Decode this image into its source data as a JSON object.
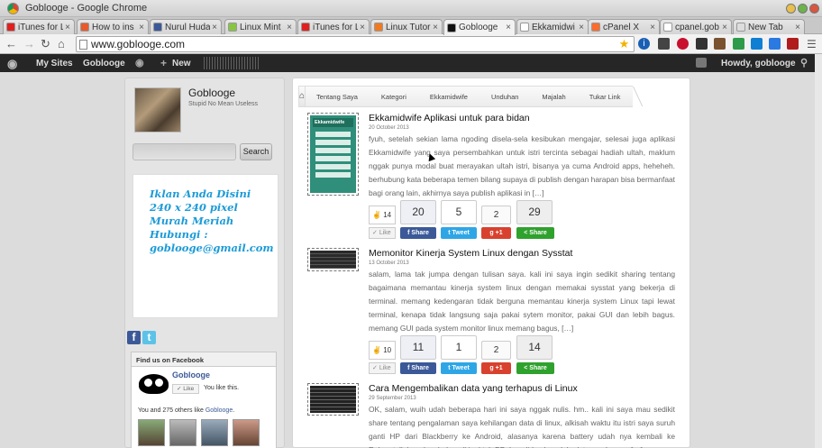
{
  "window": {
    "title": "Goblooge - Google Chrome"
  },
  "tabs": [
    {
      "label": "iTunes for L",
      "color": "#e02020"
    },
    {
      "label": "How to ins",
      "color": "#e85a2a"
    },
    {
      "label": "Nurul Huda",
      "color": "#3b5998"
    },
    {
      "label": "Linux Mint",
      "color": "#87c542"
    },
    {
      "label": "iTunes for L",
      "color": "#e02020"
    },
    {
      "label": "Linux Tutor",
      "color": "#f07a20"
    },
    {
      "label": "Goblooge",
      "color": "#111111"
    },
    {
      "label": "Ekkamidwi",
      "color": "#ffffff"
    },
    {
      "label": "cPanel X",
      "color": "#ff6c2c"
    },
    {
      "label": "cpanel.gob",
      "color": "#ffffff"
    },
    {
      "label": "New Tab",
      "color": "#dddddd"
    }
  ],
  "toolbar": {
    "url": "www.goblooge.com"
  },
  "wpbar": {
    "my_sites": "My Sites",
    "site": "Goblooge",
    "new": "New",
    "howdy": "Howdy, goblooge"
  },
  "sidebar": {
    "site_name": "Goblooge",
    "tagline": "Stupid No Mean Useless",
    "search_button": "Search",
    "search_value": "",
    "ad_lines": [
      "Iklan Anda Disini",
      "240 x 240 pixel",
      "Murah Meriah",
      "Hubungi :",
      "goblooge@gmail.com"
    ],
    "facebook": {
      "header": "Find us on Facebook",
      "page_name": "Goblooge",
      "like_label": "Like",
      "you_like": "You like this.",
      "others_prefix": "You and 275 others like ",
      "others_link": "Goblooge",
      "others_suffix": "."
    }
  },
  "breadcrumb": [
    "Tentang Saya",
    "Kategori",
    "Ekkamidwife",
    "Unduhan",
    "Majalah",
    "Tukar Link"
  ],
  "posts": [
    {
      "title": "Ekkamidwife Aplikasi untuk para bidan",
      "date": "20 October 2013",
      "excerpt": "fyuh, setelah sekian lama ngoding disela-sela kesibukan mengajar, selesai juga aplikasi Ekkamidwife yang saya persembahkan untuk istri tercinta sebagai hadiah ultah, maklum nggak punya modal buat merayakan ultah istri, bisanya ya cuma Android apps, heheheh. berhubung kata beberapa temen bilang supaya di publish dengan harapan bisa bermanfaat bagi orang lain, akhirnya saya publish aplikasi in […]",
      "like_count": "14",
      "like_label": "Like",
      "counts": {
        "facebook": "20",
        "twitter": "5",
        "gplus": "2",
        "share": "29"
      },
      "labels": {
        "facebook": "Share",
        "twitter": "Tweet",
        "gplus": "+1",
        "share": "Share"
      },
      "thumb_title": "Ekkamidwife"
    },
    {
      "title": "Memonitor Kinerja System Linux dengan Sysstat",
      "date": "13 October 2013",
      "excerpt": "salam, lama tak jumpa dengan tulisan saya. kali ini saya ingin sedikit sharing tentang bagaimana memantau kinerja system linux dengan memakai sysstat yang bekerja di terminal. memang kedengaran tidak berguna memantau kinerja system Linux tapi lewat terminal, kenapa tidak langsung saja pakai sytem monitor, pakai GUI dan lebih bagus. memang GUI pada system monitor linux memang bagus, […]",
      "like_count": "10",
      "like_label": "Like",
      "counts": {
        "facebook": "11",
        "twitter": "1",
        "gplus": "2",
        "share": "14"
      },
      "labels": {
        "facebook": "Share",
        "twitter": "Tweet",
        "gplus": "+1",
        "share": "Share"
      }
    },
    {
      "title": "Cara Mengembalikan data yang terhapus di Linux",
      "date": "29 September 2013",
      "excerpt": "OK, salam, wuih udah beberapa hari ini saya nggak nulis. hm.. kali ini saya mau sedikit share tentang pengalaman saya kehilangan data di linux, alkisah waktu itu istri saya suruh ganti HP dari Blackberry ke Android, alasanya karena battery udah nya kembali ke Rahmatullah. nah sebelum di jual tuh BB, kan di-backup dulu datanya. karena […]"
    }
  ],
  "colors": {
    "facebook": "#3b5998",
    "twitter": "#2ea6e6",
    "gplus": "#d8412e",
    "share": "#2fa12d",
    "ad_text": "#1c9bd8"
  }
}
